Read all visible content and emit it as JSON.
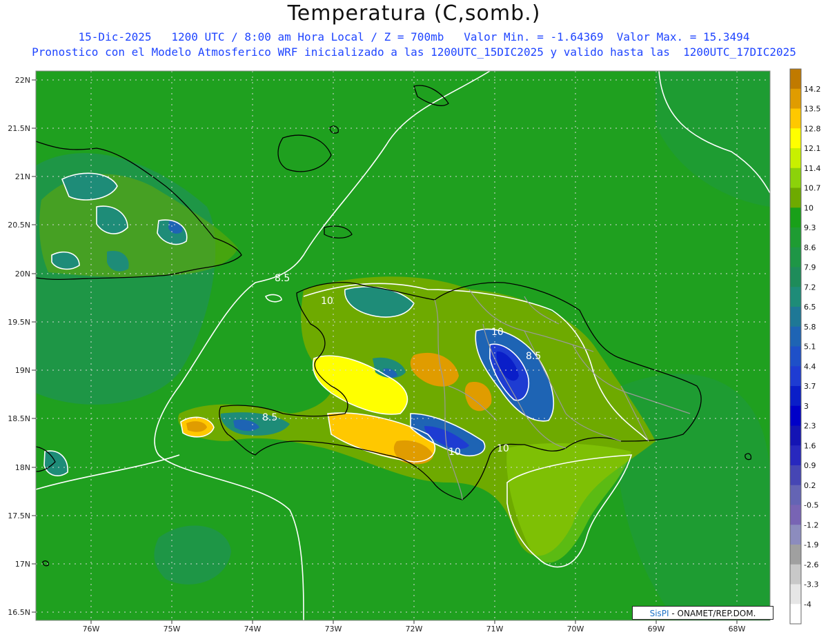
{
  "title": "Temperatura (C,somb.)",
  "subtitle_line1": "15-Dic-2025   1200 UTC / 8:00 am Hora Local / Z = 700mb   Valor Min. = -1.64369  Valor Max. = 15.3494",
  "subtitle_line2": "Pronostico con el Modelo Atmosferico WRF inicializado a las 1200UTC_15DIC2025 y valido hasta las  1200UTC_17DIC2025",
  "credit": {
    "logo": "SisPI",
    "text": " - ONAMET/REP.DOM."
  },
  "lat_labels": [
    "22N",
    "21.5N",
    "21N",
    "20.5N",
    "20N",
    "19.5N",
    "19N",
    "18.5N",
    "18N",
    "17.5N",
    "17N",
    "16.5N"
  ],
  "lon_labels": [
    "76W",
    "75W",
    "74W",
    "73W",
    "72W",
    "71W",
    "70W",
    "69W",
    "68W"
  ],
  "contour_labels": [
    "8.5",
    "10",
    "10",
    "8.5",
    "10",
    "8.5",
    "10"
  ],
  "colorbar": {
    "labels": [
      "14.2",
      "13.5",
      "12.8",
      "12.1",
      "11.4",
      "10.7",
      "10",
      "9.3",
      "8.6",
      "7.9",
      "7.2",
      "6.5",
      "5.8",
      "5.1",
      "4.4",
      "3.7",
      "3",
      "2.3",
      "1.6",
      "0.9",
      "0.2",
      "-0.5",
      "-1.2",
      "-1.9",
      "-2.6",
      "-3.3",
      "-4"
    ],
    "colors": [
      "#c07a00",
      "#e09c00",
      "#ffc800",
      "#ffff00",
      "#c8f000",
      "#8cd20a",
      "#6eaa00",
      "#19a019",
      "#1e9c32",
      "#1e9646",
      "#1e8c5a",
      "#1e8c78",
      "#1e7896",
      "#1e64b4",
      "#1e50c8",
      "#1e3cd2",
      "#0a1ec8",
      "#0000c8",
      "#1414b4",
      "#2828be",
      "#4646b4",
      "#6464b4",
      "#7864b4",
      "#8c8cbe",
      "#a0a0a0",
      "#c8c8c8",
      "#e6e6e6",
      "#ffffff"
    ]
  },
  "colors": {
    "background_field": "#1fa01f",
    "land_border": "#000000",
    "province_border": "#9a9a9a",
    "contour": "#ffffff"
  }
}
